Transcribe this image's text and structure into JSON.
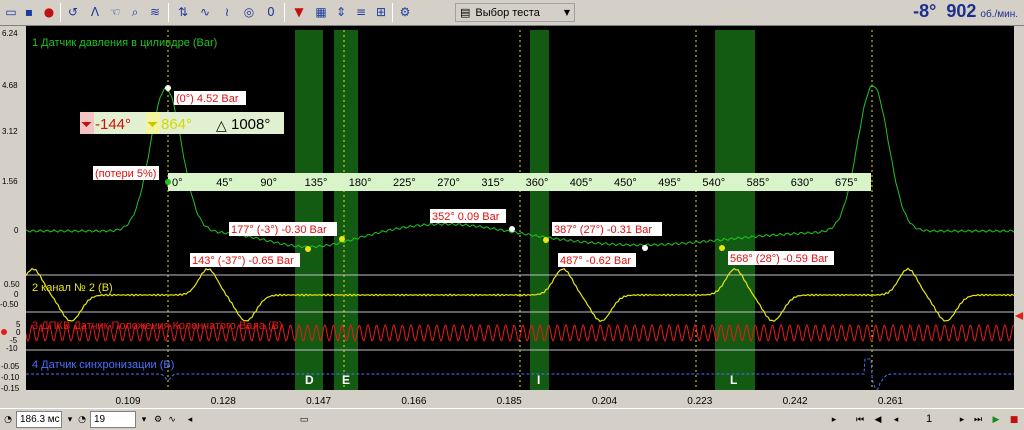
{
  "toolbar": {
    "test_select": {
      "label": "Выбор теста"
    },
    "rpm": {
      "angle": "-8°",
      "value": "902",
      "unit": "об./мин."
    }
  },
  "measure": {
    "start_angle": "-144°",
    "end_angle": "864°",
    "delta_angle": "1008°"
  },
  "y_axis_ch1": [
    "6.24",
    "4.68",
    "3.12",
    "1.56",
    "0"
  ],
  "y_axis_ch2": [
    "0.50",
    "0",
    "-0.50"
  ],
  "y_axis_ch3": [
    "5",
    "0",
    "-5",
    "-10"
  ],
  "y_axis_ch4": [
    "-0.05",
    "-0.10",
    "-0.15"
  ],
  "x_axis": [
    "0.109",
    "0.128",
    "0.147",
    "0.166",
    "0.185",
    "0.204",
    "0.223",
    "0.242",
    "0.261"
  ],
  "channels": [
    {
      "name": "1 Датчик давления в цилиндре (Bar)",
      "color": "#22c322"
    },
    {
      "name": "2 канал № 2 (B)",
      "color": "#e8e810"
    },
    {
      "name": "3 ДПКВ Датчик Положения Коленчатого Вала (B)",
      "color": "#e81a1a"
    },
    {
      "name": "4 Датчик синхронизации (B)",
      "color": "#4a70ff"
    }
  ],
  "degree_scale": [
    "0°",
    "45°",
    "90°",
    "135°",
    "180°",
    "225°",
    "270°",
    "315°",
    "360°",
    "405°",
    "450°",
    "495°",
    "540°",
    "585°",
    "630°",
    "675°"
  ],
  "annotations": {
    "peak": "(0°) 4.52 Bar",
    "loss": "(потери 5%)",
    "a177": "177° (-3°) -0.30 Bar",
    "a352": "352° 0.09 Bar",
    "a387": "387° (27°) -0.31 Bar",
    "a143": "143° (-37°) -0.65 Bar",
    "a487": "487° -0.62 Bar",
    "a568": "568° (28°) -0.59 Bar"
  },
  "phase_labels": [
    "D",
    "E",
    "I",
    "L"
  ],
  "status": {
    "time_per_div": "186.3 мс",
    "zoom": "19",
    "page": "1"
  },
  "colors": {
    "ch1": "#22c322",
    "ch2": "#e8e810",
    "ch3": "#e81a1a",
    "ch4": "#4a70ff",
    "phase_band": "#135a13",
    "degree_scale_bg": "#d8f4c8"
  }
}
